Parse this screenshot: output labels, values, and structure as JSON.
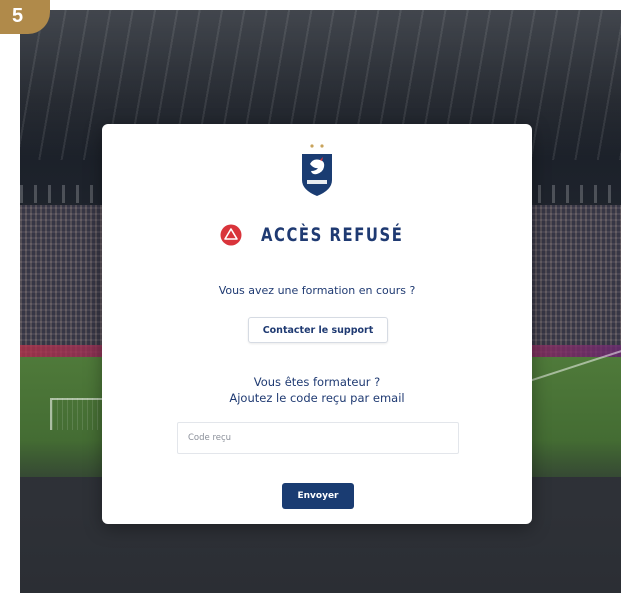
{
  "step_badge": "5",
  "colors": {
    "primary": "#1a3c72",
    "accent_red": "#d9343b",
    "badge_gold": "#b08a4a",
    "text_blue": "#1f3a72"
  },
  "logo": {
    "icon": "fff-rooster-crest-icon"
  },
  "status": {
    "icon": "alert-circle-icon",
    "title": "ACCÈS REFUSÉ"
  },
  "support": {
    "question": "Vous avez une formation en cours ?",
    "button_label": "Contacter le support"
  },
  "trainer": {
    "question": "Vous êtes formateur ?",
    "instruction": "Ajoutez le code reçu par email",
    "code_placeholder": "Code reçu",
    "code_value": "",
    "submit_label": "Envoyer"
  }
}
